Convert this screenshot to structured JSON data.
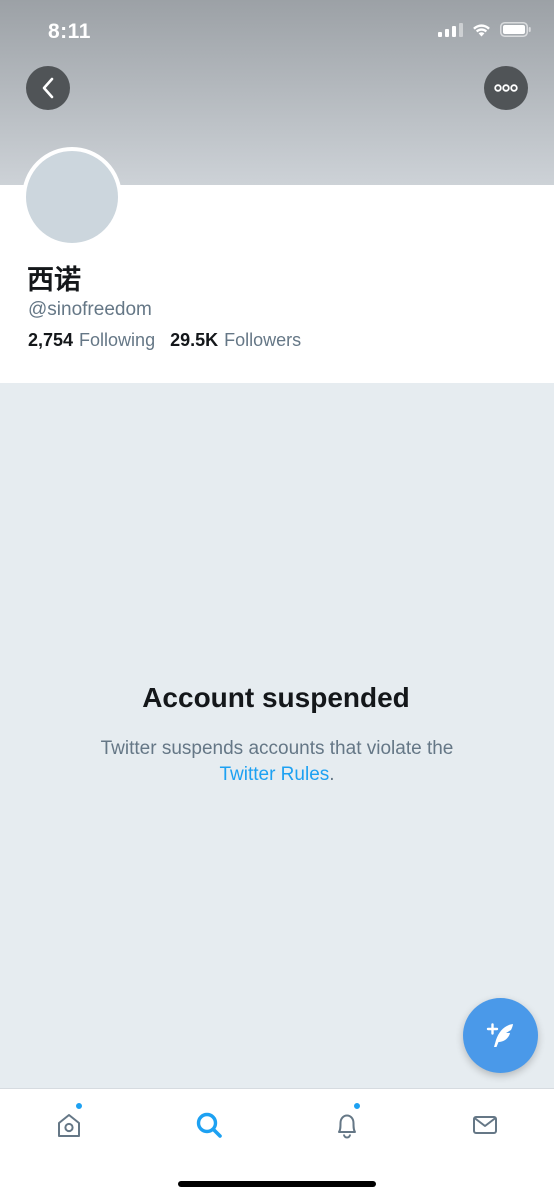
{
  "status_bar": {
    "time": "8:11",
    "icons": [
      "signal-icon",
      "wifi-icon",
      "battery-icon"
    ]
  },
  "header": {
    "back_icon": "chevron-left-icon",
    "more_icon": "more-horizontal-icon",
    "banner_color": "#aab0b5"
  },
  "profile": {
    "display_name": "西诺",
    "handle": "@sinofreedom",
    "following_count": "2,754",
    "following_label": "Following",
    "followers_count": "29.5K",
    "followers_label": "Followers",
    "avatar_color": "#ccd6dd"
  },
  "suspension": {
    "title": "Account suspended",
    "description": "Twitter suspends accounts that violate the",
    "link_text": "Twitter Rules",
    "trailing": "."
  },
  "compose": {
    "icon": "compose-tweet-icon"
  },
  "tab_bar": {
    "tabs": [
      {
        "name": "home",
        "icon": "home-icon",
        "active": false,
        "badge": true
      },
      {
        "name": "search",
        "icon": "search-icon",
        "active": true,
        "badge": false
      },
      {
        "name": "notifications",
        "icon": "bell-icon",
        "active": false,
        "badge": true
      },
      {
        "name": "messages",
        "icon": "mail-icon",
        "active": false,
        "badge": false
      }
    ]
  },
  "colors": {
    "accent": "#1da1f2",
    "fab": "#4a99e9",
    "background": "#e6ecf0",
    "text_primary": "#14171a",
    "text_secondary": "#657786"
  }
}
